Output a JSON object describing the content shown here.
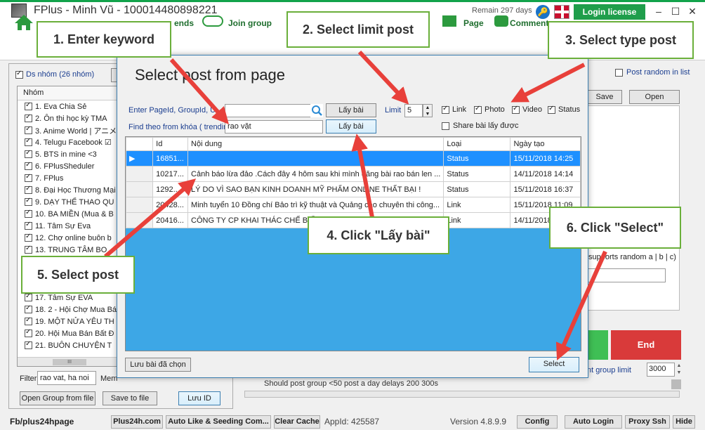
{
  "app": {
    "title": "FPlus - Minh Vũ - 100014480898221",
    "remain": "Remain 297 days",
    "login_label": "Login license"
  },
  "nav": {
    "items": [
      "ends",
      "Join group",
      "Page",
      "Comment"
    ]
  },
  "left": {
    "ds_nhom": "Ds nhóm (26 nhóm)",
    "nhom_header": "Nhóm",
    "groups": [
      "1. Eva Chia Sẻ",
      "2. Ôn thi học kỳ TMA",
      "3. Anime World | アニメ",
      "4. Telugu Facebook ☑",
      "5. BTS in mine <3",
      "6. FPlusSheduler",
      "7. FPlus",
      "8. Đại Học Thương Mại",
      "9. DẠY THỂ THAO QU",
      "10. BA MIỀN (Mua & B",
      "11. Tâm Sự Eva",
      "12. Chợ online buôn b",
      "13. TRUNG TÂM BO",
      "",
      "",
      "",
      "17. Tâm Sự EVA",
      "18. 2 - Hội Chợ Mua Bá",
      "19. MỘT NỬA YÊU TH",
      "20. Hội Mua Bán Bất Đ",
      "21. BUÔN CHUYỆN T"
    ],
    "scroll_thumb": "III",
    "filter_label": "Filter",
    "filter_value": "rao vat, ha noi",
    "mem_label": "Mem",
    "open_group_file": "Open Group from file",
    "save_to_file": "Save to file",
    "luu_id": "Lưu ID"
  },
  "right": {
    "post_random": "Post random in list",
    "save": "Save",
    "open": "Open",
    "supports_random": "supports random a | b | c)",
    "end": "End",
    "group_limit_label": "nt group limit",
    "group_limit_value": "3000",
    "status_text": "Should post group <50 post a day delays 200 300s"
  },
  "statusbar": {
    "fb": "Fb/plus24hpage",
    "plus24h": "Plus24h.com",
    "auto_like": "Auto Like & Seeding Com...",
    "clear_cache": "Clear Cache",
    "appid": "AppId: 425587",
    "version": "Version 4.8.9.9",
    "config": "Config",
    "auto_login": "Auto Login",
    "proxy_ssh": "Proxy Ssh",
    "hide": "Hide"
  },
  "dialog": {
    "title": "Select post from page",
    "enter_pageid": "Enter PageId, GroupId, U",
    "find_keyword": "Find theo from khóa ( trending",
    "keyword_value": "rao vặt",
    "lay_bai": "Lấy bài",
    "limit_label": "Limit",
    "limit_value": "5",
    "chk_link": "Link",
    "chk_photo": "Photo",
    "chk_video": "Video",
    "chk_status": "Status",
    "share_bai": "Share bài lấy được",
    "columns": [
      "Id",
      "Nội dung",
      "Loại",
      "Ngày tạo"
    ],
    "rows": [
      [
        "16851...",
        "",
        "Status",
        "15/11/2018 14:25"
      ],
      [
        "10217...",
        "Cảnh báo lừa đảo .Cách đây 4 hôm sau khi mình đăng bài rao bán len ...",
        "Status",
        "14/11/2018 14:14"
      ],
      [
        "1292...",
        "LÝ DO VÌ SAO BẠN KINH DOANH MỸ PHẨM ONLINE THẤT BẠI !",
        "Status",
        "15/11/2018 16:37"
      ],
      [
        "20428...",
        "Minh tuyển 10 Đồng chí Bảo trì kỹ thuật và Quảng cáo chuyên thi công...",
        "Link",
        "15/11/2018 11:09"
      ],
      [
        "20416...",
        "CÔNG TY CP KHAI THÁC CHẾ BIẾN",
        "Link",
        "14/11/2018 11:36"
      ]
    ],
    "luu_bai": "Lưu bài đã chọn",
    "select": "Select"
  },
  "callouts": {
    "c1": "1. Enter keyword",
    "c2": "2. Select limit post",
    "c3": "3. Select type post",
    "c4": "4. Click \"Lấy bài\"",
    "c5": "5. Select post",
    "c6": "6. Click \"Select\""
  },
  "colors": {
    "accent_green": "#6aaf3a",
    "arrow_red": "#e8403a",
    "selection_blue": "#1e90ff",
    "grid_bg": "#3da7e6",
    "end_red": "#d93a3a"
  }
}
